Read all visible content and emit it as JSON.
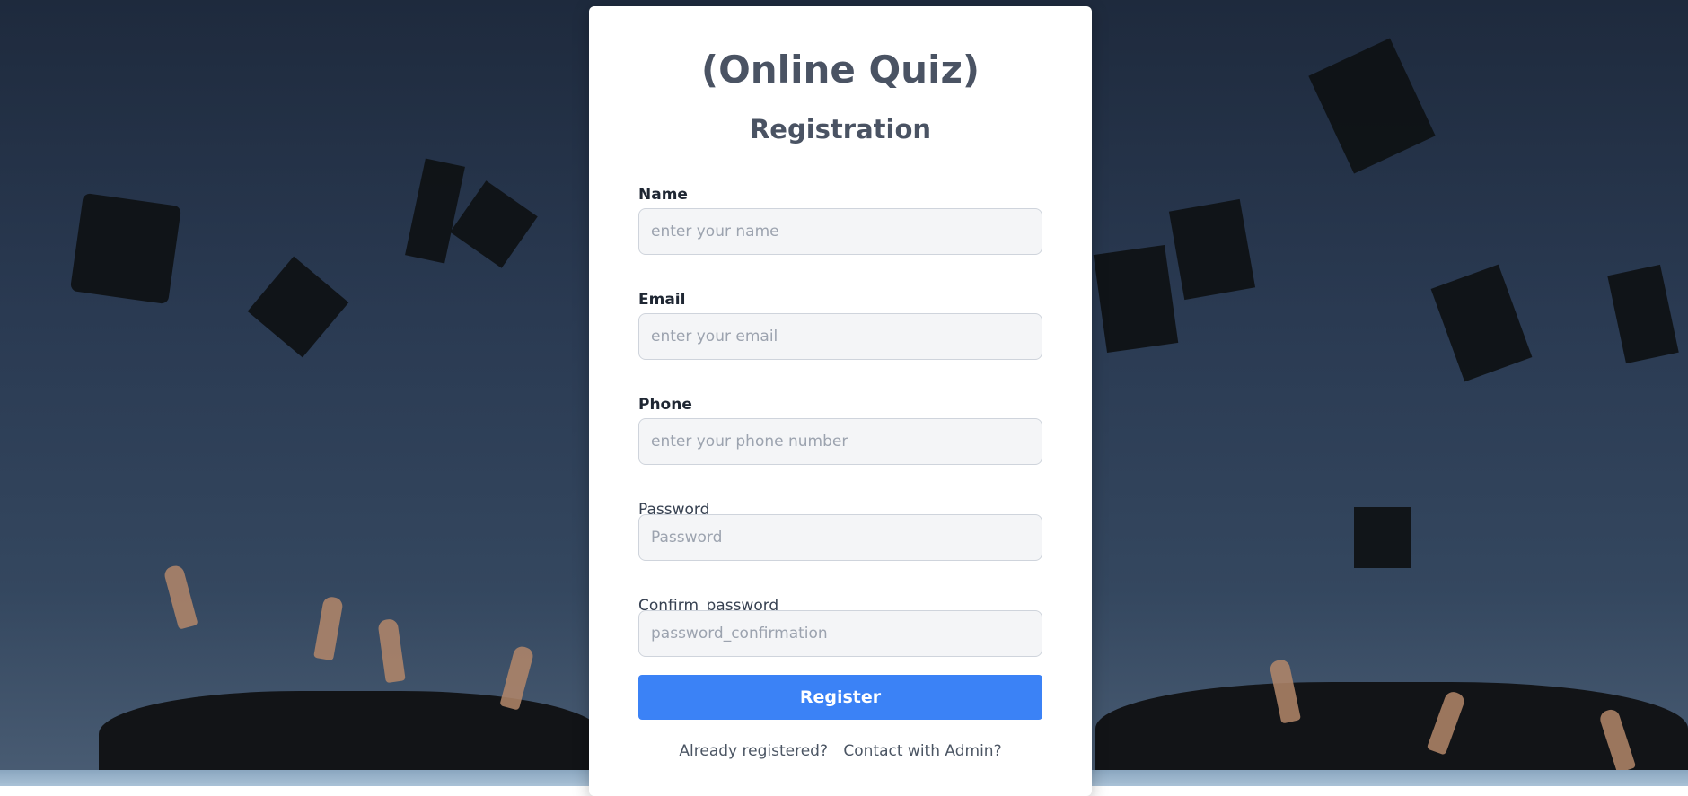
{
  "header": {
    "title": "(Online Quiz)",
    "subtitle": "Registration"
  },
  "form": {
    "name_label": "Name",
    "name_placeholder": "enter your name",
    "email_label": "Email",
    "email_placeholder": "enter your email",
    "phone_label": "Phone",
    "phone_placeholder": "enter your phone number",
    "password_label": "Password",
    "password_placeholder": "Password",
    "confirm_label": "Confirm_password",
    "confirm_placeholder": "password_confirmation",
    "register_label": "Register"
  },
  "links": {
    "already_registered": "Already registered?",
    "contact_admin": "Contact with Admin?"
  },
  "colors": {
    "primary": "#3b82f6",
    "title": "#4a5363",
    "card": "#ffffff"
  }
}
